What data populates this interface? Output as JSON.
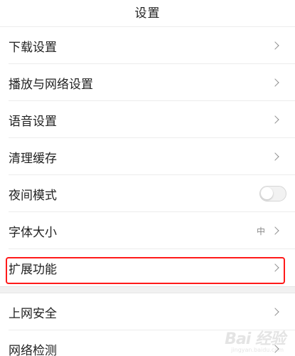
{
  "header": {
    "title": "设置"
  },
  "settings": {
    "group1": [
      {
        "label": "下载设置",
        "type": "chevron"
      },
      {
        "label": "播放与网络设置",
        "type": "chevron"
      },
      {
        "label": "语音设置",
        "type": "chevron"
      },
      {
        "label": "清理缓存",
        "type": "chevron"
      },
      {
        "label": "夜间模式",
        "type": "toggle",
        "on": false
      },
      {
        "label": "字体大小",
        "type": "value",
        "value": "中"
      },
      {
        "label": "扩展功能",
        "type": "chevron",
        "highlighted": true
      }
    ],
    "group2": [
      {
        "label": "上网安全",
        "type": "chevron"
      },
      {
        "label": "网络检测",
        "type": "chevron"
      }
    ]
  },
  "annotation": {
    "highlight_color": "#ff1a1a"
  },
  "watermark": {
    "text": "Bai 经验",
    "sub": "jingyan.baidu.com"
  },
  "icons": {
    "chevron": "chevron-right-icon",
    "toggle": "toggle-switch"
  }
}
